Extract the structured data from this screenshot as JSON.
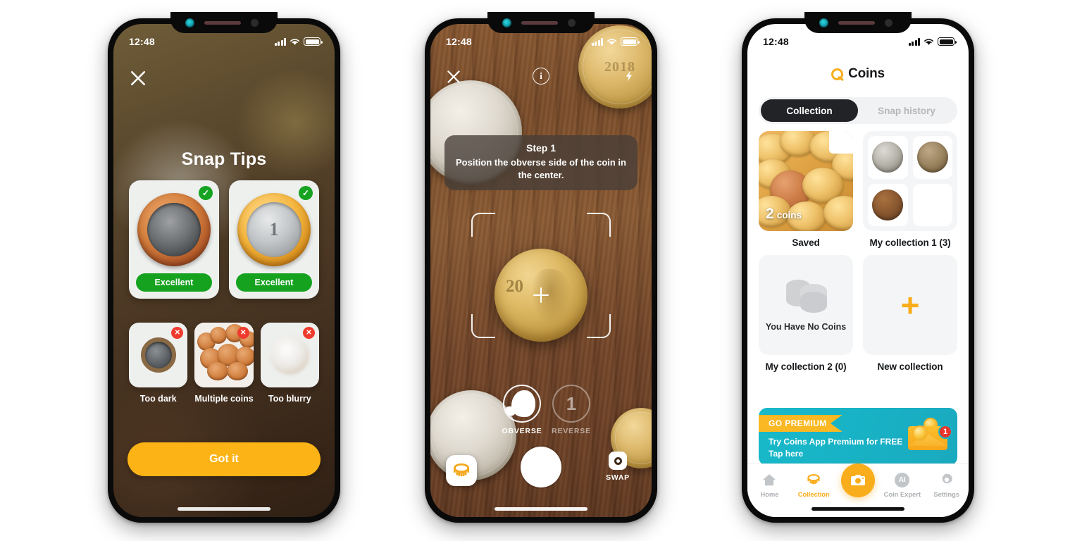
{
  "phone1": {
    "status": {
      "time": "12:48",
      "signal_icon": "signal-bars-icon",
      "wifi_icon": "wifi-icon",
      "battery_icon": "battery-icon"
    },
    "close_icon": "close-icon",
    "title": "Snap Tips",
    "good_examples": [
      {
        "badge": "✓",
        "badge_type": "ok",
        "quality_label": "Excellent",
        "coin": "brazil-1-real-obverse",
        "face_text": ""
      },
      {
        "badge": "✓",
        "badge_type": "ok",
        "quality_label": "Excellent",
        "coin": "brazil-1-real-reverse",
        "face_text": "1"
      }
    ],
    "bad_examples": [
      {
        "badge": "✕",
        "badge_type": "bad",
        "label": "Too dark",
        "kind": "dark"
      },
      {
        "badge": "✕",
        "badge_type": "bad",
        "label": "Multiple coins",
        "kind": "multiple"
      },
      {
        "badge": "✕",
        "badge_type": "bad",
        "label": "Too blurry",
        "kind": "blurry"
      }
    ],
    "primary_button": "Got it",
    "accent_color": "#fcb315",
    "ok_color": "#16a321",
    "bad_color": "#ef3b2d"
  },
  "phone2": {
    "status": {
      "time": "12:48"
    },
    "close_icon": "close-icon",
    "info_icon": "info-icon",
    "flash_icon": "flash-icon",
    "tooltip": {
      "step": "Step 1",
      "text": "Position the obverse side of the coin in the center."
    },
    "controls": {
      "obverse_label": "OBVERSE",
      "reverse_label": "REVERSE",
      "reverse_number": "1",
      "shutter_icon": "shutter-button",
      "gallery_icon": "coin-app-icon",
      "swap_label": "SWAP",
      "swap_icon": "swap-camera-icon"
    },
    "hero_coin_text": "20"
  },
  "phone3": {
    "status": {
      "time": "12:48"
    },
    "header": {
      "logo_icon": "coin-logo-icon",
      "title": "Coins"
    },
    "tabs": [
      {
        "label": "Collection",
        "active": true
      },
      {
        "label": "Snap history",
        "active": false
      }
    ],
    "collections": [
      {
        "caption": "Saved",
        "type": "photo",
        "count_number": "2",
        "count_word": "coins"
      },
      {
        "caption": "My collection 1 (3)",
        "type": "mini-grid",
        "coins": 3
      },
      {
        "caption": "My collection 2 (0)",
        "type": "empty",
        "empty_text": "You Have No Coins",
        "icon": "coin-stack-icon"
      },
      {
        "caption": "New collection",
        "type": "new",
        "icon": "plus-icon"
      }
    ],
    "promo": {
      "ribbon": "GO PREMIUM",
      "line1": "Try Coins App Premium for FREE",
      "line2": "Tap here",
      "badge_count": "1",
      "icon": "envelope-coins-icon",
      "bg_color": "#18b3c6",
      "ribbon_color": "#f9b824"
    },
    "tabbar": [
      {
        "label": "Home",
        "icon": "home-icon",
        "active": false
      },
      {
        "label": "Collection",
        "icon": "collection-coin-icon",
        "active": true
      },
      {
        "label": "",
        "icon": "camera-icon",
        "active": false,
        "primary": true
      },
      {
        "label": "Coin Expert",
        "icon": "ai-icon",
        "active": false
      },
      {
        "label": "Settings",
        "icon": "gear-icon",
        "active": false
      }
    ],
    "accent_color": "#f9ad1b"
  }
}
